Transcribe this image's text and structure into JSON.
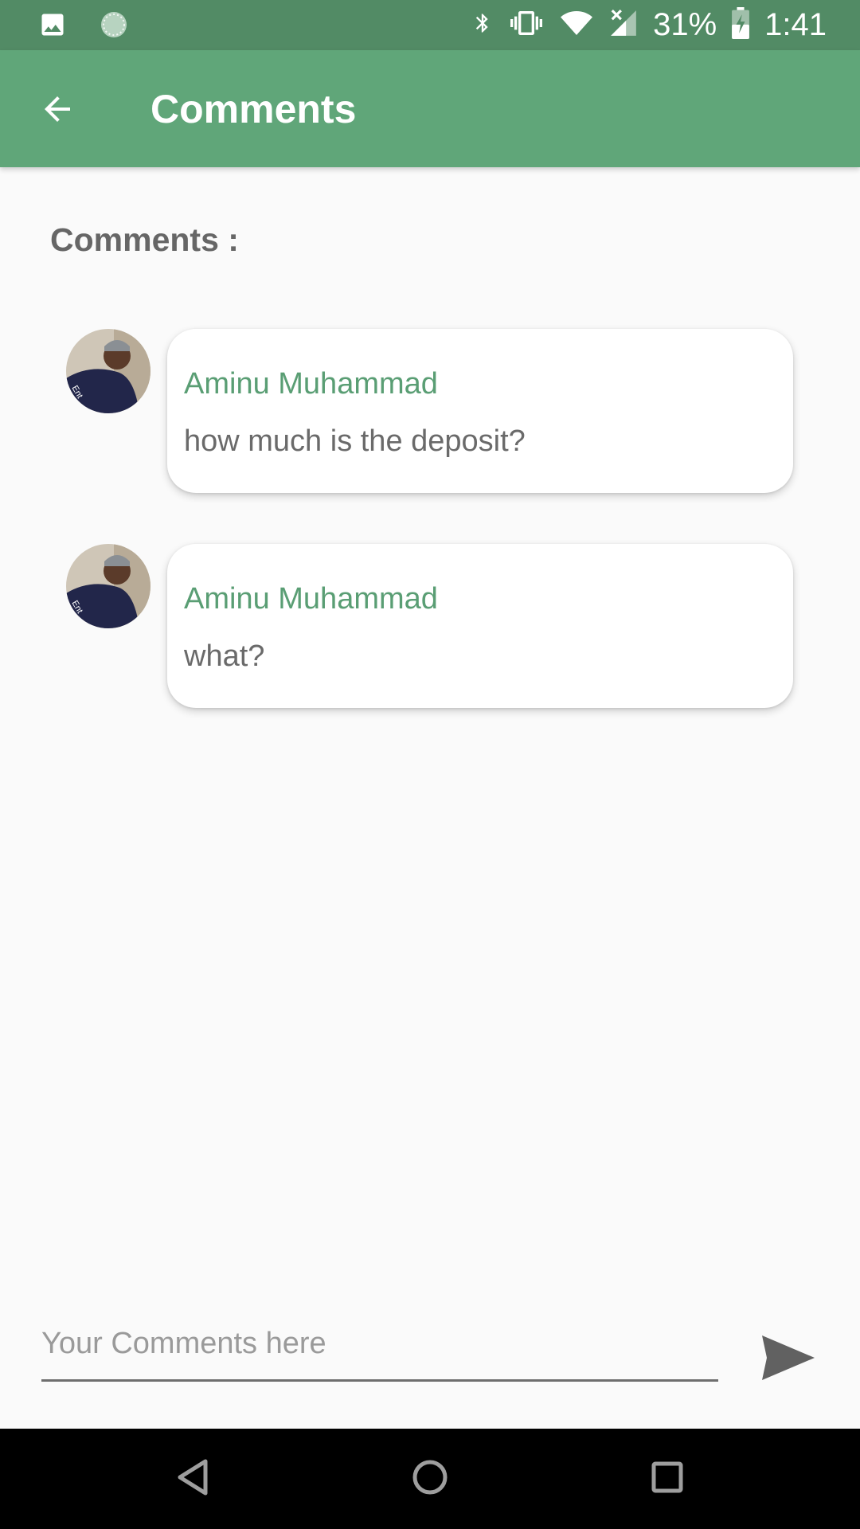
{
  "status_bar": {
    "battery_percent": "31%",
    "time": "1:41",
    "icons": [
      "image-icon",
      "loading-circle-icon",
      "bluetooth-icon",
      "vibrate-icon",
      "wifi-icon",
      "cellular-signal-icon",
      "battery-charging-icon"
    ]
  },
  "app_bar": {
    "title": "Comments",
    "back_icon": "arrow-back-icon",
    "color": "#60a679"
  },
  "section": {
    "heading": "Comments :"
  },
  "comments": [
    {
      "author": "Aminu Muhammad",
      "text": "how much is the deposit?"
    },
    {
      "author": "Aminu Muhammad",
      "text": "what?"
    }
  ],
  "input": {
    "placeholder": "Your Comments here",
    "value": ""
  },
  "send": {
    "icon": "send-icon"
  },
  "nav_bar": {
    "icons": [
      "back-triangle-icon",
      "home-circle-icon",
      "recents-square-icon"
    ]
  },
  "colors": {
    "accent": "#60a679",
    "status_bar": "#528b65",
    "author_text": "#5a9e74"
  }
}
